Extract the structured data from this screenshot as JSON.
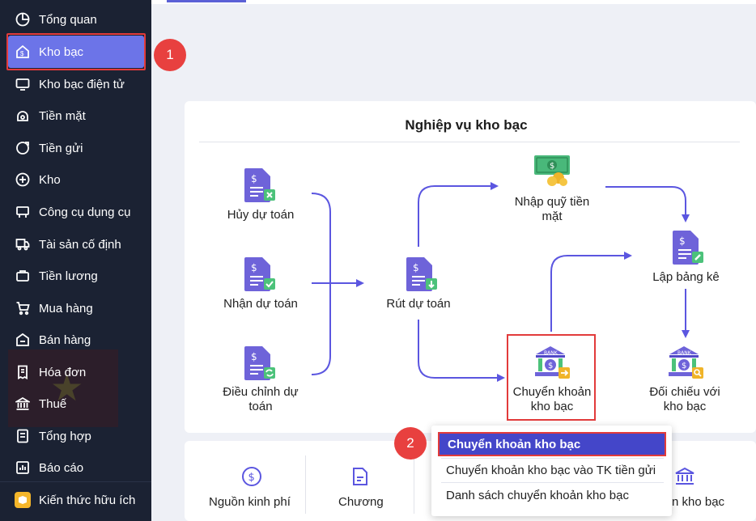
{
  "sidebar": {
    "items": [
      {
        "label": "Tổng quan",
        "icon": "pie-chart-icon"
      },
      {
        "label": "Kho bạc",
        "icon": "treasury-icon"
      },
      {
        "label": "Kho bạc điện tử",
        "icon": "e-treasury-icon"
      },
      {
        "label": "Tiền mặt",
        "icon": "cash-icon"
      },
      {
        "label": "Tiền gửi",
        "icon": "deposit-icon"
      },
      {
        "label": "Kho",
        "icon": "warehouse-icon"
      },
      {
        "label": "Công cụ dụng cụ",
        "icon": "tools-icon"
      },
      {
        "label": "Tài sản cố định",
        "icon": "truck-icon"
      },
      {
        "label": "Tiền lương",
        "icon": "salary-icon"
      },
      {
        "label": "Mua hàng",
        "icon": "cart-icon"
      },
      {
        "label": "Bán hàng",
        "icon": "sell-icon"
      },
      {
        "label": "Hóa đơn",
        "icon": "invoice-icon"
      },
      {
        "label": "Thuế",
        "icon": "bank-icon"
      },
      {
        "label": "Tổng hợp",
        "icon": "summary-icon"
      },
      {
        "label": "Báo cáo",
        "icon": "report-icon"
      }
    ],
    "active_index": 1,
    "knowledge_label": "Kiến thức hữu ích"
  },
  "badges": {
    "one": "1",
    "two": "2"
  },
  "card": {
    "title": "Nghiệp vụ kho bạc",
    "nodes": {
      "huy_du_toan": "Hủy dự toán",
      "nhan_du_toan": "Nhận dự toán",
      "dieu_chinh_du_toan_1": "Điều chỉnh dự",
      "dieu_chinh_du_toan_2": "toán",
      "rut_du_toan": "Rút dự toán",
      "nhap_quy_1": "Nhập quỹ tiền",
      "nhap_quy_2": "mặt",
      "lap_bang_ke": "Lập bảng kê",
      "chuyen_khoan_1": "Chuyển khoản",
      "chuyen_khoan_2": "kho bạc",
      "doi_chieu_1": "Đối chiếu với",
      "doi_chieu_2": "kho bạc"
    }
  },
  "bottom": {
    "nguon_kinh_phi": "Nguồn kinh phí",
    "chuong": "Chương",
    "tk_kho_bac": "n kho bạc"
  },
  "dropdown": {
    "items": [
      "Chuyển khoản kho bạc",
      "Chuyển khoản kho bạc vào TK tiền gửi",
      "Danh sách chuyển khoản kho bạc"
    ],
    "selected_index": 0
  },
  "colors": {
    "sidebar_bg": "#1b2233",
    "active": "#6c74e8",
    "accent": "#5b60d6",
    "highlight": "#e23b3b",
    "doc_purple": "#6e63d9",
    "doc_green": "#4cc27a"
  }
}
